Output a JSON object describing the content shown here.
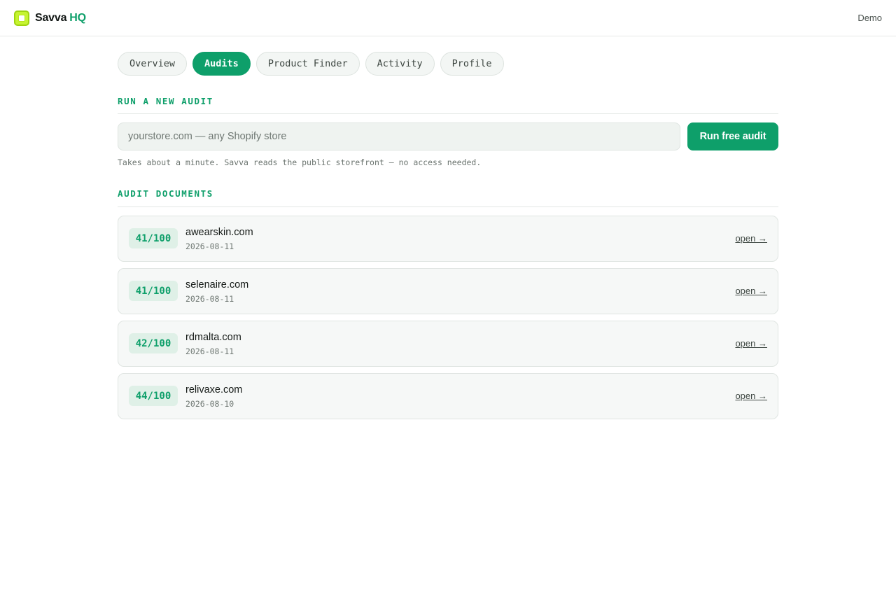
{
  "header": {
    "brand_name": "Savva",
    "brand_accent": "HQ",
    "user_label": "Demo"
  },
  "tabs": [
    {
      "label": "Overview",
      "active": false
    },
    {
      "label": "Audits",
      "active": true
    },
    {
      "label": "Product Finder",
      "active": false
    },
    {
      "label": "Activity",
      "active": false
    },
    {
      "label": "Profile",
      "active": false
    }
  ],
  "new_audit": {
    "title": "RUN A NEW AUDIT",
    "input_value": "",
    "input_placeholder": "yourstore.com — any Shopify store",
    "button_label": "Run free audit",
    "hint": "Takes about a minute. Savva reads the public storefront — no access needed."
  },
  "documents": {
    "title": "AUDIT DOCUMENTS",
    "link_label": "open →",
    "items": [
      {
        "score": "41/100",
        "domain": "awearskin.com",
        "date": "2026-08-11"
      },
      {
        "score": "41/100",
        "domain": "selenaire.com",
        "date": "2026-08-11"
      },
      {
        "score": "42/100",
        "domain": "rdmalta.com",
        "date": "2026-08-11"
      },
      {
        "score": "44/100",
        "domain": "relivaxe.com",
        "date": "2026-08-10"
      }
    ]
  },
  "colors": {
    "accent": "#0e9f6a",
    "logo": "#c6f431"
  },
  "icons": {
    "logo": "savva-logo-icon"
  }
}
